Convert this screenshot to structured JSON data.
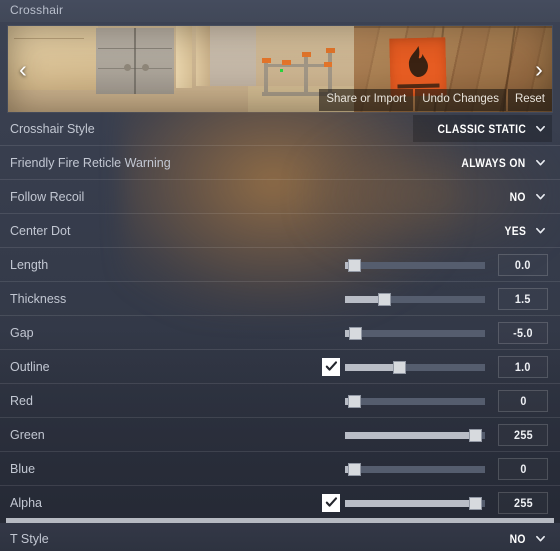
{
  "header": {
    "title": "Crosshair"
  },
  "preview": {
    "prev_arrow": "‹",
    "next_arrow": "›",
    "buttons": [
      {
        "label": "Share or Import",
        "name": "share-or-import-button"
      },
      {
        "label": "Undo Changes",
        "name": "undo-changes-button"
      },
      {
        "label": "Reset",
        "name": "reset-button"
      }
    ]
  },
  "settings": {
    "dropdown_rows": [
      {
        "label": "Crosshair Style",
        "value": "CLASSIC STATIC",
        "highlighted": true
      },
      {
        "label": "Friendly Fire Reticle Warning",
        "value": "ALWAYS ON",
        "highlighted": false
      },
      {
        "label": "Follow Recoil",
        "value": "NO",
        "highlighted": false
      },
      {
        "label": "Center Dot",
        "value": "YES",
        "highlighted": false
      }
    ],
    "slider_rows": [
      {
        "label": "Length",
        "value": "0.0",
        "percent": 2,
        "checkbox": null
      },
      {
        "label": "Thickness",
        "value": "1.5",
        "percent": 26,
        "checkbox": null
      },
      {
        "label": "Gap",
        "value": "-5.0",
        "percent": 3,
        "checkbox": null
      },
      {
        "label": "Outline",
        "value": "1.0",
        "percent": 38,
        "checkbox": true
      },
      {
        "label": "Red",
        "value": "0",
        "percent": 2,
        "checkbox": null
      },
      {
        "label": "Green",
        "value": "255",
        "percent": 98,
        "checkbox": null
      },
      {
        "label": "Blue",
        "value": "0",
        "percent": 2,
        "checkbox": null
      },
      {
        "label": "Alpha",
        "value": "255",
        "percent": 98,
        "checkbox": true
      }
    ],
    "last_row": {
      "label": "T Style",
      "value": "NO"
    }
  },
  "colors": {
    "panel_bg": "#343a49",
    "header_bg": "#434a5b",
    "label_text": "#c2c7d2",
    "value_text": "#ffffff",
    "slider_track": "#555d6e",
    "slider_fill": "#b9bdc6",
    "slider_handle": "#d7dade",
    "accent_orange": "#e65c22",
    "crosshair_green": "#27d43a"
  }
}
